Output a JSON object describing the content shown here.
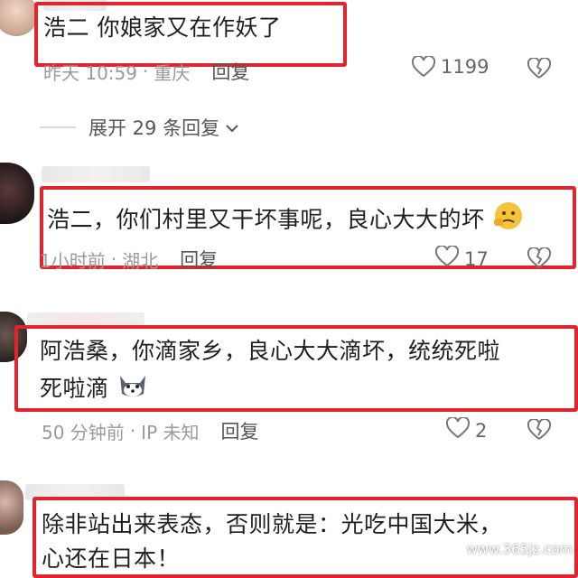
{
  "comments": [
    {
      "text": "浩二  你娘家又在作妖了",
      "time": "昨天 10:59",
      "location": "重庆",
      "reply_label": "回复",
      "likes": "1199"
    },
    {
      "text": "浩二，你们村里又干坏事呢，良心大大的坏",
      "time": "1小时前",
      "location": "湖北",
      "reply_label": "回复",
      "likes": "17"
    },
    {
      "text_line1": "阿浩桑，你滴家乡，良心大大滴坏，统统死啦",
      "text_line2": "死啦滴",
      "time": "50 分钟前",
      "location": "IP 未知",
      "reply_label": "回复",
      "likes": "2"
    },
    {
      "text_line1": "除非站出来表态，否则就是：光吃中国大米，",
      "text_line2": "心还在日本！"
    }
  ],
  "expand_replies": "展开 29 条回复",
  "watermark": "www.365jz.com",
  "colors": {
    "highlight": "#e0252e",
    "meta": "#9a9a9a"
  }
}
